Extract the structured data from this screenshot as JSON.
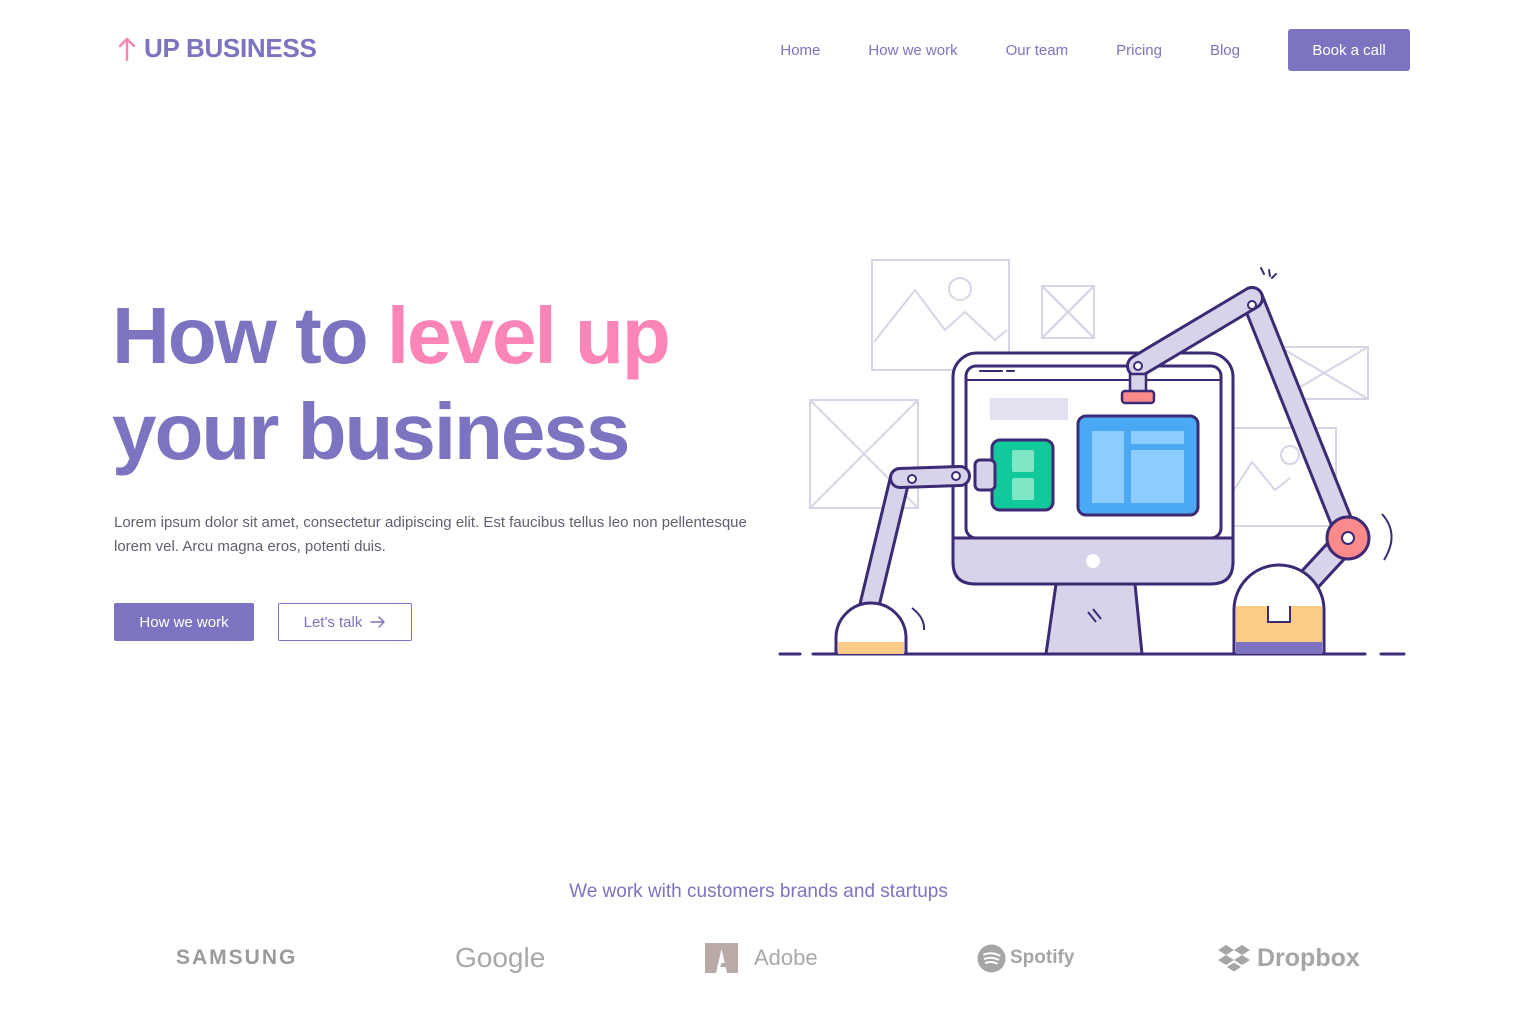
{
  "brand": {
    "name": "UP BUSINESS",
    "icon": "arrow-up-icon",
    "icon_color": "#fb85b6",
    "color": "#7c74c0"
  },
  "nav": {
    "items": [
      {
        "label": "Home"
      },
      {
        "label": "How we work"
      },
      {
        "label": "Our team"
      },
      {
        "label": "Pricing"
      },
      {
        "label": "Blog"
      }
    ],
    "cta": "Book a call"
  },
  "hero": {
    "title_part1": "How to ",
    "title_accent": "level up",
    "title_part2": "your business",
    "description": "Lorem ipsum dolor sit amet, consectetur adipiscing elit. Est faucibus tellus leo non pellentesque lorem vel. Arcu magna eros, potenti duis.",
    "primary_button": "How we work",
    "secondary_button": "Let's talk",
    "secondary_button_icon": "arrow-right-icon",
    "illustration": "robot-arms-building-website-illustration"
  },
  "partners": {
    "title": "We work with customers brands and startups",
    "brands": [
      {
        "name": "SAMSUNG"
      },
      {
        "name": "Google"
      },
      {
        "name": "Adobe",
        "icon": "adobe-logo-icon"
      },
      {
        "name": "Spotify",
        "icon": "spotify-logo-icon"
      },
      {
        "name": "Dropbox",
        "icon": "dropbox-logo-icon"
      }
    ]
  },
  "colors": {
    "primary": "#7c74c0",
    "accent": "#fb85b6",
    "text": "#5f5f72",
    "logo_gray": "#a9a9a9"
  }
}
